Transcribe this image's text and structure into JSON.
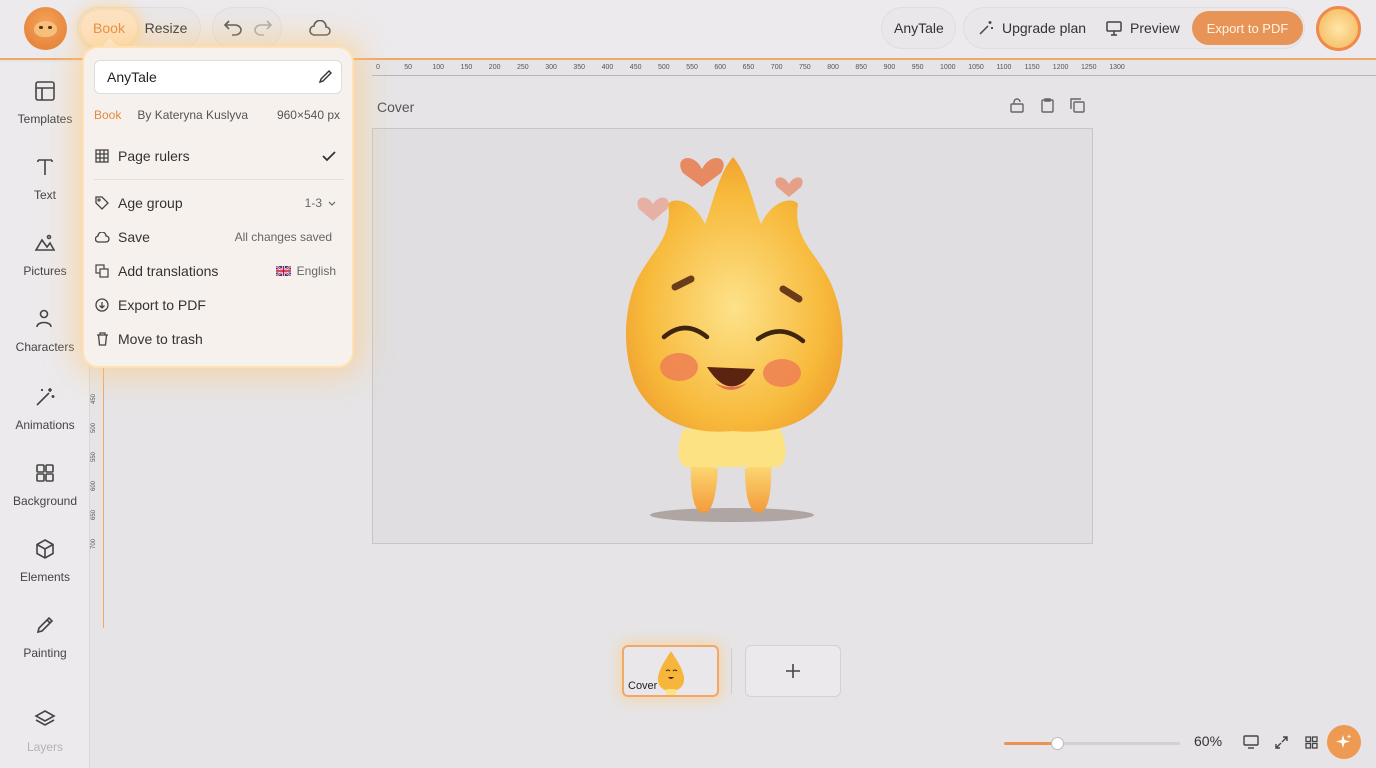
{
  "topbar": {
    "book_tab": "Book",
    "resize_tab": "Resize",
    "project_name": "AnyTale",
    "upgrade_label": "Upgrade plan",
    "preview_label": "Preview",
    "export_label": "Export to PDF"
  },
  "sidebar": {
    "items": [
      {
        "label": "Templates",
        "icon": "templates-icon"
      },
      {
        "label": "Text",
        "icon": "text-icon"
      },
      {
        "label": "Pictures",
        "icon": "pictures-icon"
      },
      {
        "label": "Characters",
        "icon": "characters-icon"
      },
      {
        "label": "Animations",
        "icon": "animations-icon"
      },
      {
        "label": "Background",
        "icon": "background-icon"
      },
      {
        "label": "Elements",
        "icon": "elements-icon"
      },
      {
        "label": "Painting",
        "icon": "painting-icon"
      },
      {
        "label": "Layers",
        "icon": "layers-icon"
      }
    ]
  },
  "menu": {
    "name_value": "AnyTale",
    "meta_type": "Book",
    "meta_author": "By Kateryna Kuslyva",
    "meta_size": "960×540 px",
    "page_rulers": "Page rulers",
    "age_group": "Age group",
    "age_value": "1-3",
    "save": "Save",
    "save_status": "All changes saved",
    "add_translations": "Add translations",
    "language": "English",
    "export_pdf": "Export to PDF",
    "move_trash": "Move to trash"
  },
  "ruler": {
    "top_ticks": [
      "0",
      "50",
      "100",
      "150",
      "200",
      "250",
      "300",
      "350",
      "400",
      "450",
      "500",
      "550",
      "600",
      "650",
      "700",
      "750",
      "800",
      "850",
      "900",
      "950",
      "1000",
      "1050",
      "1100",
      "1150",
      "1200",
      "1250",
      "1300"
    ],
    "left_ticks": [
      "450",
      "500",
      "550",
      "600",
      "650",
      "700"
    ]
  },
  "canvas": {
    "page_title": "Cover"
  },
  "pages": {
    "thumb_label": "Cover"
  },
  "zoom": {
    "value": "60%",
    "fraction": 0.3
  },
  "colors": {
    "accent": "#e89456",
    "highlight": "#f0a869"
  }
}
